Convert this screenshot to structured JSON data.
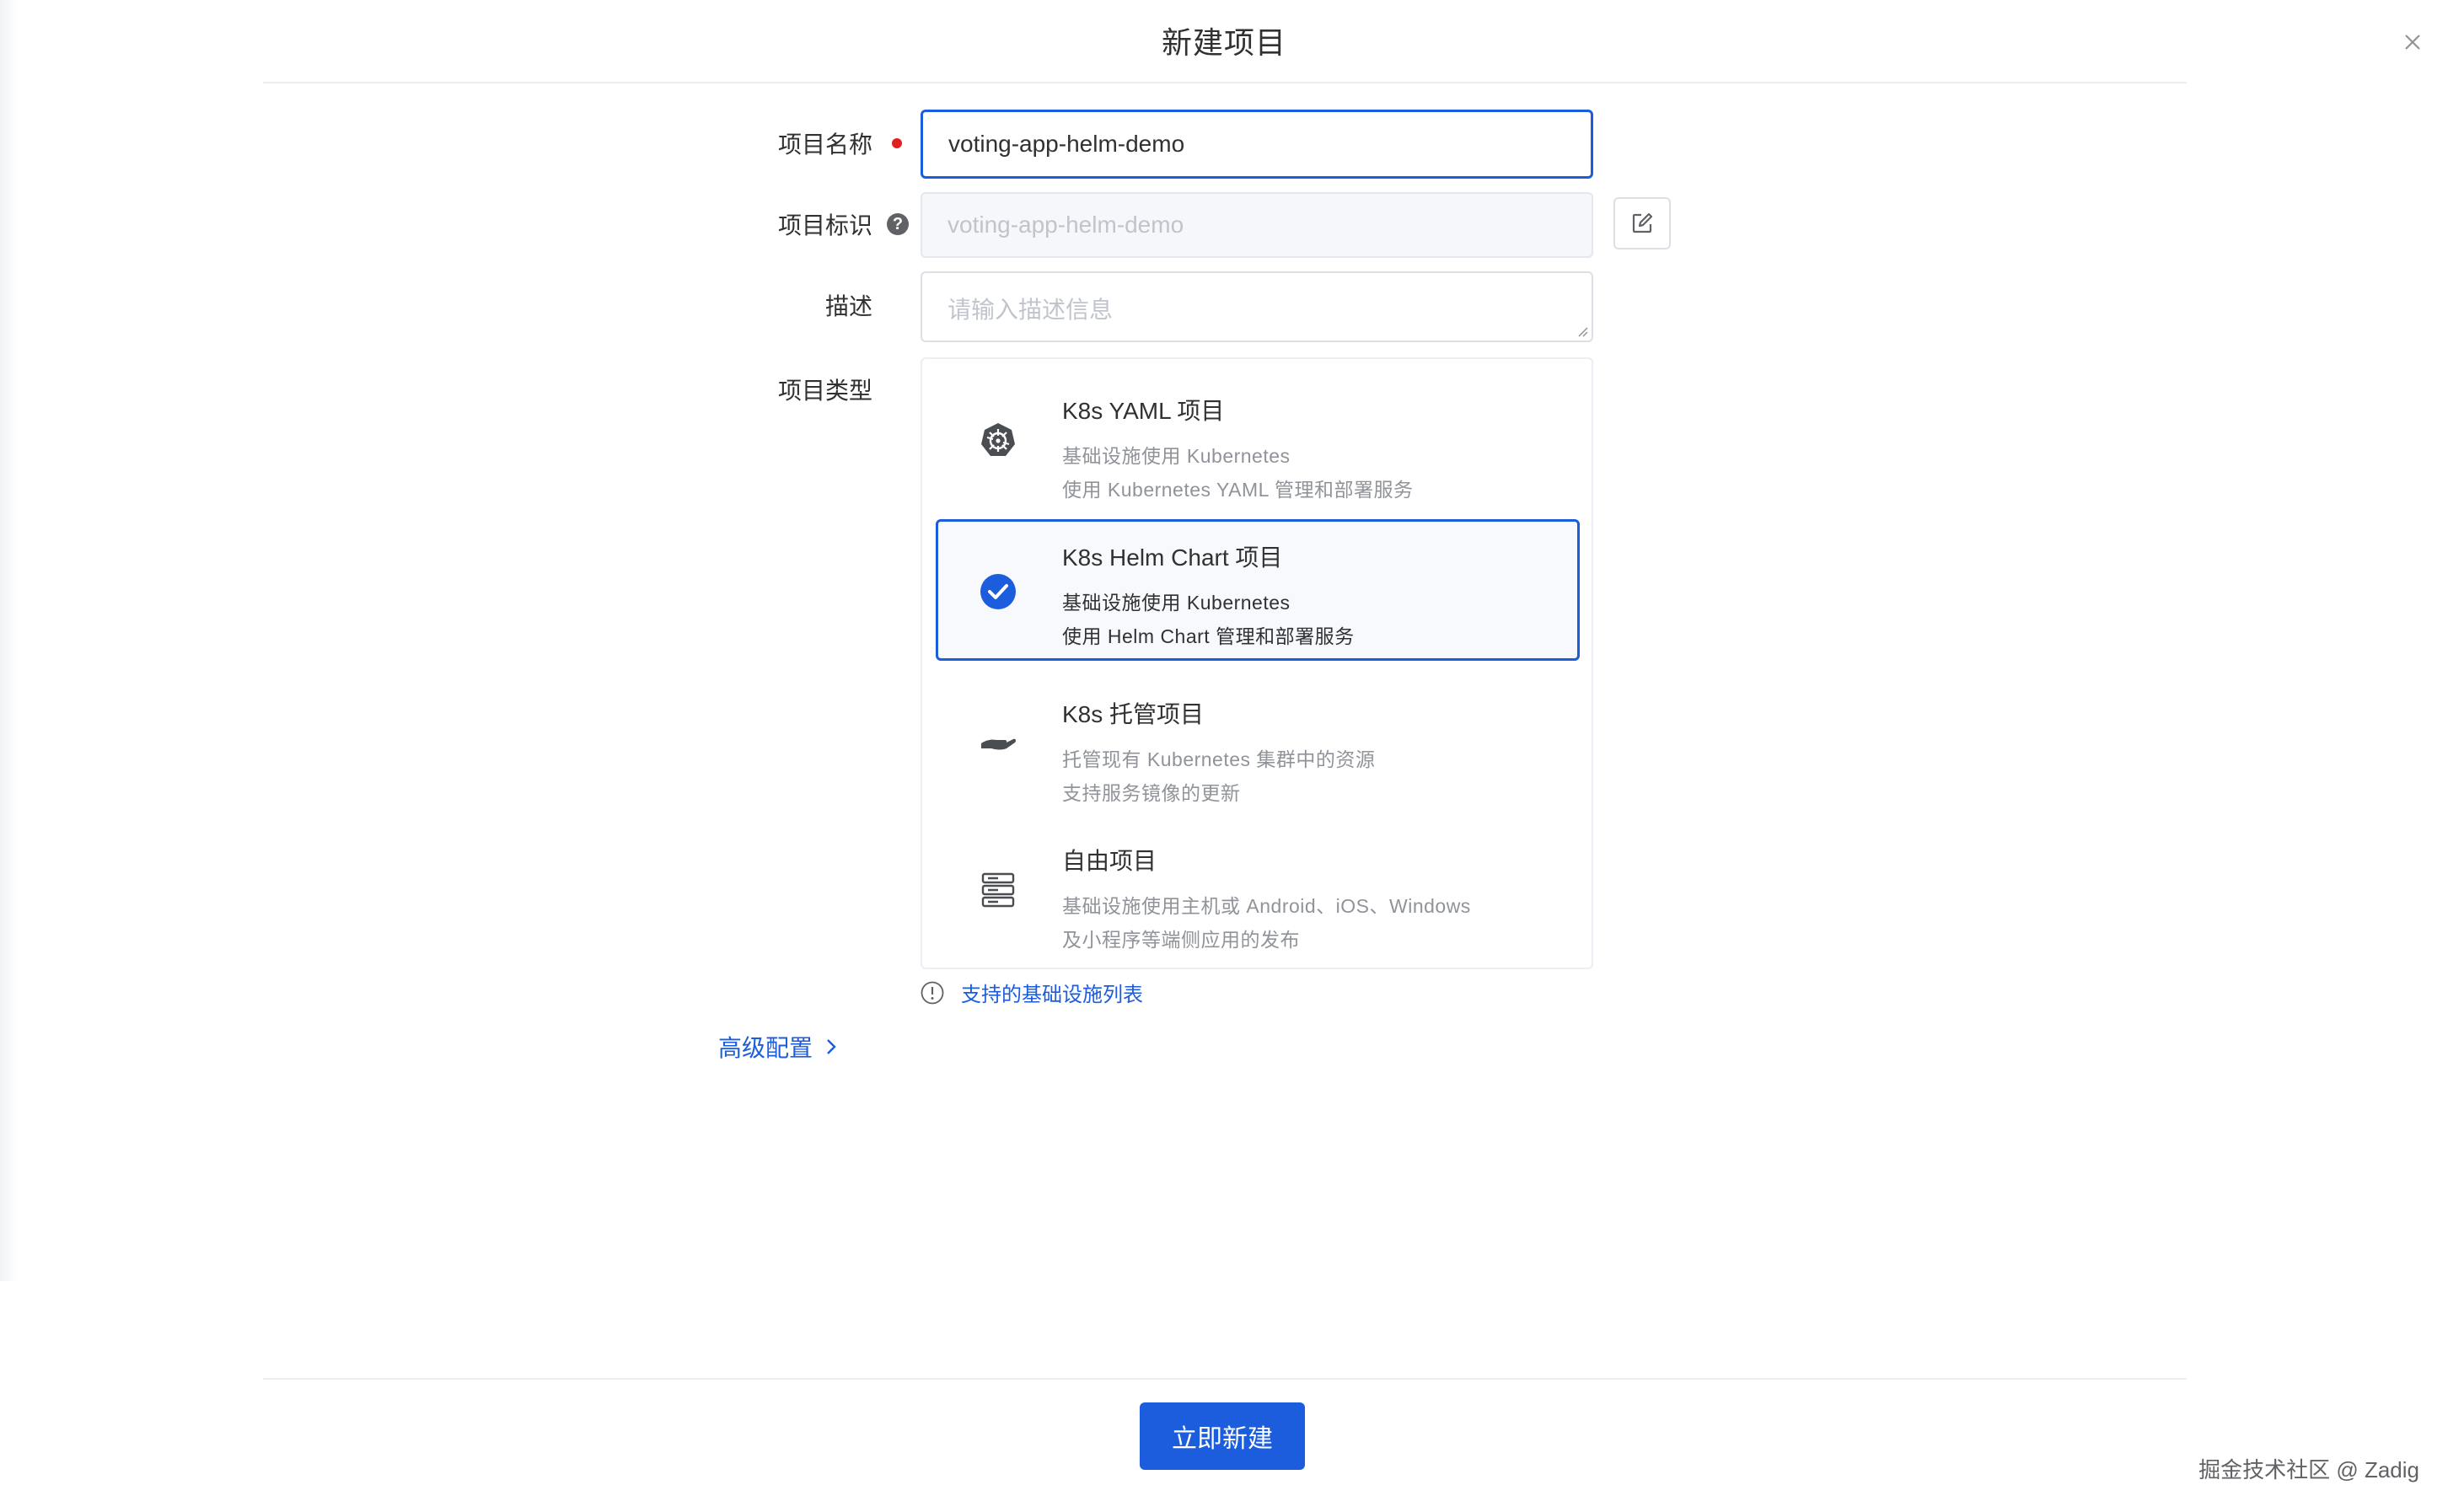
{
  "dialog": {
    "title": "新建项目"
  },
  "form": {
    "name": {
      "label": "项目名称",
      "value": "voting-app-helm-demo"
    },
    "key": {
      "label": "项目标识",
      "value": "voting-app-helm-demo"
    },
    "description": {
      "label": "描述",
      "placeholder": "请输入描述信息"
    },
    "type": {
      "label": "项目类型",
      "options": [
        {
          "title": "K8s YAML 项目",
          "line1": "基础设施使用 Kubernetes",
          "line2": "使用 Kubernetes YAML 管理和部署服务",
          "icon": "kubernetes-icon",
          "selected": false
        },
        {
          "title": "K8s Helm Chart 项目",
          "line1": "基础设施使用 Kubernetes",
          "line2": "使用 Helm Chart 管理和部署服务",
          "icon": "check-circle-icon",
          "selected": true
        },
        {
          "title": "K8s 托管项目",
          "line1": "托管现有 Kubernetes 集群中的资源",
          "line2": "支持服务镜像的更新",
          "icon": "hand-icon",
          "selected": false
        },
        {
          "title": "自由项目",
          "line1": "基础设施使用主机或 Android、iOS、Windows",
          "line2": "及小程序等端侧应用的发布",
          "icon": "server-icon",
          "selected": false
        }
      ]
    },
    "infra_link": "支持的基础设施列表",
    "advanced": "高级配置"
  },
  "footer": {
    "submit": "立即新建"
  },
  "watermark": "掘金技术社区 @ Zadig",
  "colors": {
    "primary": "#1b5ddc",
    "required": "#e02020",
    "border": "#dcdfe6",
    "muted_text": "#909399"
  }
}
